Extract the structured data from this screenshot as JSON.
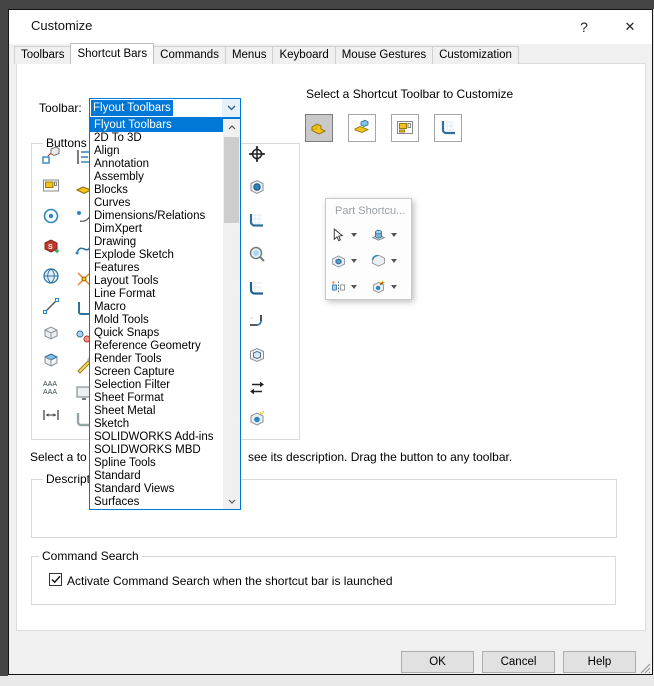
{
  "window": {
    "title": "Customize",
    "help_glyph": "?",
    "close_glyph": "✕"
  },
  "tabs": [
    {
      "label": "Toolbars",
      "active": false
    },
    {
      "label": "Shortcut Bars",
      "active": true
    },
    {
      "label": "Commands",
      "active": false
    },
    {
      "label": "Menus",
      "active": false
    },
    {
      "label": "Keyboard",
      "active": false
    },
    {
      "label": "Mouse Gestures",
      "active": false
    },
    {
      "label": "Customization",
      "active": false
    }
  ],
  "toolbar_picker": {
    "label": "Toolbar:",
    "value": "Flyout Toolbars",
    "selected_index": 0,
    "items": [
      "Flyout Toolbars",
      "2D To 3D",
      "Align",
      "Annotation",
      "Assembly",
      "Blocks",
      "Curves",
      "Dimensions/Relations",
      "DimXpert",
      "Drawing",
      "Explode Sketch",
      "Features",
      "Layout Tools",
      "Line Format",
      "Macro",
      "Mold Tools",
      "Quick Snaps",
      "Reference Geometry",
      "Render Tools",
      "Screen Capture",
      "Selection Filter",
      "Sheet Format",
      "Sheet Metal",
      "Sketch",
      "SOLIDWORKS Add-ins",
      "SOLIDWORKS MBD",
      "Spline Tools",
      "Standard",
      "Standard Views",
      "Surfaces"
    ]
  },
  "shortcut_select": {
    "heading": "Select a Shortcut Toolbar to Customize",
    "buttons": [
      {
        "name": "part",
        "icon": "part-icon",
        "selected": true
      },
      {
        "name": "assembly",
        "icon": "assembly-doc-icon",
        "selected": false
      },
      {
        "name": "drawing",
        "icon": "drawing-doc-icon",
        "selected": false
      },
      {
        "name": "sketch",
        "icon": "sketch-doc-icon",
        "selected": false
      }
    ]
  },
  "buttons_group": {
    "label": "Buttons",
    "left_icons": [
      "2d-to-3d-icon",
      "sheet-format-icon",
      "blocks-icon",
      "solidworks-addins-icon",
      "render-tools-icon",
      "line-format-icon",
      "reference-geometry-icon",
      "mold-tools-icon",
      "annotation-icon",
      "dimxpert-icon"
    ],
    "middle_icons": [
      "align-icon",
      "assembly-part-icon",
      "dimensions-icon",
      "curves-icon",
      "explode-sketch-icon",
      "layout-tools-icon",
      "macro-icon",
      "quick-snaps-icon",
      "screen-capture-icon",
      "sheet-metal-icon"
    ],
    "right_icons": [
      "origin-icon",
      "reference-sphere-icon",
      "sketch-grid-icon",
      "zoom-icon",
      "sketch-3d-icon",
      "corner-rectangle-icon",
      "hollow-cube-icon",
      "swap-arrows-icon",
      "appearance-icon"
    ]
  },
  "part_shortcut_panel": {
    "title": "Part Shortcu...",
    "items": [
      "select-cursor-icon",
      "boss-extrude-icon",
      "extruded-cut-icon",
      "fillet-icon",
      "mirror-icon",
      "edit-appearance-icon"
    ]
  },
  "hint": {
    "left_fragment": "Select a to",
    "right_fragment": "see its description. Drag the button to any toolbar."
  },
  "description_group": {
    "label": "Description"
  },
  "command_search": {
    "label": "Command Search",
    "checkbox_label": "Activate Command Search when the shortcut bar is launched",
    "checked": true
  },
  "footer": {
    "ok": "OK",
    "cancel": "Cancel",
    "help": "Help"
  },
  "colors": {
    "accent": "#0078d7",
    "selection_bg": "#0078d7",
    "dialog_bg": "#f0f0f0",
    "panel_bg": "#ffffff"
  }
}
